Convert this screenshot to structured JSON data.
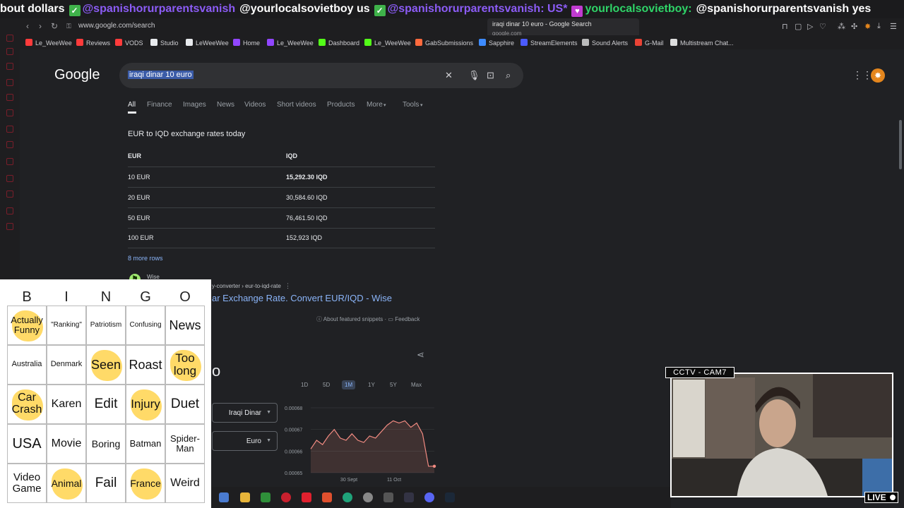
{
  "ticker": {
    "s1": "bout dollars",
    "s2": "@spanishorurparentsvanish",
    "s3": "@yourlocalsovietboy us",
    "s4": "@spanishorurparentsvanish: US*",
    "s5": "yourlocalsovietboy:",
    "s6": "@spanishorurparentsvanish yes"
  },
  "browser": {
    "url": "www.google.com/search",
    "tab_popup_title": "iraqi dinar 10 euro - Google Search",
    "tab_popup_domain": "google.com"
  },
  "bookmarks": [
    {
      "label": "Le_WeeWee",
      "color": "#ff3b3b"
    },
    {
      "label": "Reviews",
      "color": "#ff3b3b"
    },
    {
      "label": "VODS",
      "color": "#ff3b3b"
    },
    {
      "label": "Studio",
      "color": "#e8eaed"
    },
    {
      "label": "LeWeeWee",
      "color": "#e8eaed"
    },
    {
      "label": "Home",
      "color": "#9146ff"
    },
    {
      "label": "Le_WeeWee",
      "color": "#9146ff"
    },
    {
      "label": "Dashboard",
      "color": "#53fc18"
    },
    {
      "label": "Le_WeeWee",
      "color": "#53fc18"
    },
    {
      "label": "GabSubmissions",
      "color": "#ff6a3d"
    },
    {
      "label": "Sapphire",
      "color": "#3d8bff"
    },
    {
      "label": "StreamElements",
      "color": "#4b5bff"
    },
    {
      "label": "Sound Alerts",
      "color": "#bbbbbb"
    },
    {
      "label": "G-Mail",
      "color": "#ea4335"
    },
    {
      "label": "Multistream Chat...",
      "color": "#dddddd"
    }
  ],
  "google": {
    "logo": "Google",
    "query": "iraqi dinar 10 euro",
    "tabs": [
      "All",
      "Finance",
      "Images",
      "News",
      "Videos",
      "Short videos",
      "Products",
      "More",
      "Tools"
    ]
  },
  "fx": {
    "title": "EUR to IQD exchange rates today",
    "col1": "EUR",
    "col2": "IQD",
    "rows": [
      {
        "eur": "10 EUR",
        "iqd": "15,292.30 IQD"
      },
      {
        "eur": "20 EUR",
        "iqd": "30,584.60 IQD"
      },
      {
        "eur": "50 EUR",
        "iqd": "76,461.50 IQD"
      },
      {
        "eur": "100 EUR",
        "iqd": "152,923 IQD"
      }
    ],
    "more_rows": "8 more rows"
  },
  "result": {
    "site": "Wise",
    "breadcrumb": "y-converter › eur-to-iqd-rate",
    "title": "ar Exchange Rate. Convert EUR/IQD - Wise",
    "about": "About featured snippets",
    "feedback": "Feedback",
    "big_o": "o"
  },
  "converter": {
    "ranges": [
      "1D",
      "5D",
      "1M",
      "1Y",
      "5Y",
      "Max"
    ],
    "from": "Iraqi Dinar",
    "to": "Euro"
  },
  "chart_data": {
    "type": "line",
    "x_tick_labels": [
      "30 Sept",
      "11 Oct"
    ],
    "ylim": [
      0.00065,
      0.00068
    ],
    "y_ticks": [
      "0.00068",
      "0.00067",
      "0.00066",
      "0.00065"
    ],
    "values": [
      0.000661,
      0.000665,
      0.000663,
      0.000667,
      0.00067,
      0.000666,
      0.000665,
      0.000668,
      0.000665,
      0.000664,
      0.000667,
      0.000666,
      0.000669,
      0.000672,
      0.000674,
      0.000673,
      0.000674,
      0.000671,
      0.000673,
      0.000668,
      0.000653,
      0.000653
    ],
    "color": "#f28b82"
  },
  "bingo": {
    "letters": [
      "B",
      "I",
      "N",
      "G",
      "O"
    ],
    "cells": [
      {
        "text": "Actually Funny",
        "marked": true,
        "size": 13
      },
      {
        "text": "\"Ranking\"",
        "marked": false,
        "size": 10
      },
      {
        "text": "Patriotism",
        "marked": false,
        "size": 10
      },
      {
        "text": "Confusing",
        "marked": false,
        "size": 10
      },
      {
        "text": "News",
        "marked": false,
        "size": 18
      },
      {
        "text": "Australia",
        "marked": false,
        "size": 11
      },
      {
        "text": "Denmark",
        "marked": false,
        "size": 11
      },
      {
        "text": "Seen",
        "marked": true,
        "size": 18
      },
      {
        "text": "Roast",
        "marked": false,
        "size": 18
      },
      {
        "text": "Too long",
        "marked": true,
        "size": 17
      },
      {
        "text": "Car Crash",
        "marked": true,
        "size": 16
      },
      {
        "text": "Karen",
        "marked": false,
        "size": 16
      },
      {
        "text": "Edit",
        "marked": false,
        "size": 19
      },
      {
        "text": "Injury",
        "marked": true,
        "size": 17
      },
      {
        "text": "Duet",
        "marked": false,
        "size": 19
      },
      {
        "text": "USA",
        "marked": false,
        "size": 20
      },
      {
        "text": "Movie",
        "marked": false,
        "size": 16
      },
      {
        "text": "Boring",
        "marked": false,
        "size": 14
      },
      {
        "text": "Batman",
        "marked": false,
        "size": 13
      },
      {
        "text": "Spider-Man",
        "marked": false,
        "size": 13
      },
      {
        "text": "Video Game",
        "marked": false,
        "size": 15
      },
      {
        "text": "Animal",
        "marked": true,
        "size": 14
      },
      {
        "text": "Fail",
        "marked": false,
        "size": 19
      },
      {
        "text": "France",
        "marked": true,
        "size": 14
      },
      {
        "text": "Weird",
        "marked": false,
        "size": 16
      }
    ]
  },
  "stream": {
    "cam_label": "CCTV - CAM7",
    "live": "LIVE"
  }
}
